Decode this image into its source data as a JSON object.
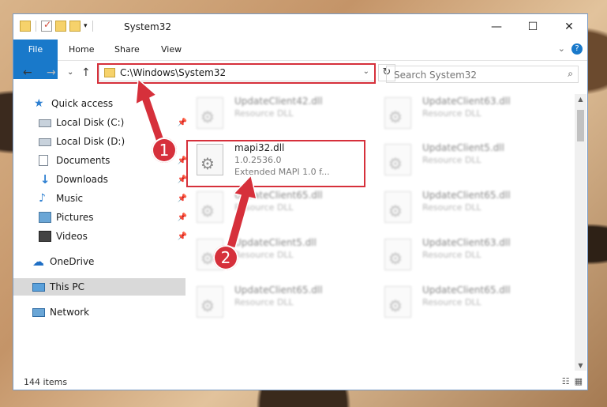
{
  "window": {
    "title": "System32",
    "controls": {
      "minimize": "—",
      "maximize": "☐",
      "close": "✕"
    }
  },
  "ribbon": {
    "tabs": [
      "File",
      "Home",
      "Share",
      "View"
    ],
    "expand_icon": "⌄",
    "help_icon": "?"
  },
  "navigation": {
    "back": "←",
    "forward": "→",
    "recent": "⌄",
    "up": "↑",
    "address": "C:\\Windows\\System32",
    "dropdown": "⌄",
    "refresh": "↻"
  },
  "search": {
    "placeholder": "Search System32",
    "icon": "⌕"
  },
  "sidebar": {
    "items": [
      {
        "label": "Quick access",
        "icon": "star-icon"
      },
      {
        "label": "Local Disk (C:)",
        "icon": "drive-icon",
        "pinned": "📌"
      },
      {
        "label": "Local Disk (D:)",
        "icon": "drive-icon"
      },
      {
        "label": "Documents",
        "icon": "document-icon",
        "pinned": "📌"
      },
      {
        "label": "Downloads",
        "icon": "download-icon",
        "pinned": "📌"
      },
      {
        "label": "Music",
        "icon": "music-icon",
        "pinned": "📌"
      },
      {
        "label": "Pictures",
        "icon": "pictures-icon",
        "pinned": "📌"
      },
      {
        "label": "Videos",
        "icon": "videos-icon",
        "pinned": "📌"
      },
      {
        "label": "OneDrive",
        "icon": "cloud-icon"
      },
      {
        "label": "This PC",
        "icon": "computer-icon",
        "selected": true
      },
      {
        "label": "Network",
        "icon": "network-icon"
      }
    ]
  },
  "files": [
    {
      "name": "UpdateClient42.dll",
      "type": "Resource DLL"
    },
    {
      "name": "UpdateClient63.dll",
      "type": "Resource DLL"
    },
    {
      "name": "mapi32.dll",
      "version": "1.0.2536.0",
      "description": "Extended MAPI 1.0 f..."
    },
    {
      "name": "UpdateClient5.dll",
      "type": "Resource DLL"
    },
    {
      "name": "UpdateClient65.dll",
      "type": "Resource DLL"
    },
    {
      "name": "UpdateClient65.dll",
      "type": "Resource DLL"
    },
    {
      "name": "UpdateClient5.dll",
      "type": "Resource DLL"
    },
    {
      "name": "UpdateClient63.dll",
      "type": "Resource DLL"
    },
    {
      "name": "UpdateClient65.dll",
      "type": "Resource DLL"
    },
    {
      "name": "UpdateClient65.dll",
      "type": "Resource DLL"
    }
  ],
  "status": {
    "count": "144 items"
  },
  "annotations": {
    "step1": "1",
    "step2": "2",
    "color": "#d6303b"
  }
}
